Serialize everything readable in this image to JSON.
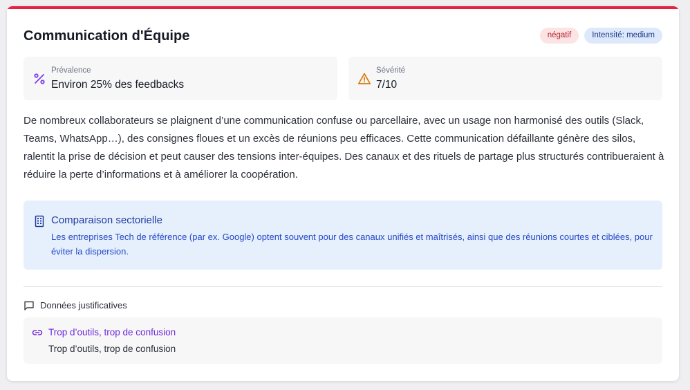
{
  "card": {
    "title": "Communication d'Équipe",
    "badges": {
      "sentiment": "négatif",
      "intensity": "Intensité: medium"
    }
  },
  "metrics": {
    "prevalence": {
      "label": "Prévalence",
      "value": "Environ 25% des feedbacks",
      "icon": "percent-icon"
    },
    "severity": {
      "label": "Sévérité",
      "value": "7/10",
      "icon": "warning-triangle-icon"
    }
  },
  "description": "De nombreux collaborateurs se plaignent d’une communication confuse ou parcellaire, avec un usage non harmonisé des outils (Slack, Teams, WhatsApp…), des consignes floues et un excès de réunions peu efficaces. Cette communication défaillante génère des silos, ralentit la prise de décision et peut causer des tensions inter-équipes. Des canaux et des rituels de partage plus structurés contribueraient à réduire la perte d’informations et à améliorer la coopération.",
  "comparison": {
    "title": "Comparaison sectorielle",
    "text": "Les entreprises Tech de référence (par ex. Google) optent souvent pour des canaux unifiés et maîtrisés, ainsi que des réunions courtes et ciblées, pour éviter la dispersion.",
    "icon": "building-icon"
  },
  "evidence": {
    "heading": "Données justificatives",
    "heading_icon": "message-square-icon",
    "items": [
      {
        "link": "Trop d’outils, trop de confusion",
        "quote": "Trop d’outils, trop de confusion",
        "icon": "link-icon"
      }
    ]
  },
  "colors": {
    "accent_bar": "#e5223f",
    "negative_badge_bg": "#fde4e4",
    "intensity_badge_bg": "#dde9fb",
    "comparison_bg": "#e6f0fc",
    "link": "#6d28d9",
    "percent_icon": "#7c3aed",
    "warning_icon": "#d97706"
  }
}
